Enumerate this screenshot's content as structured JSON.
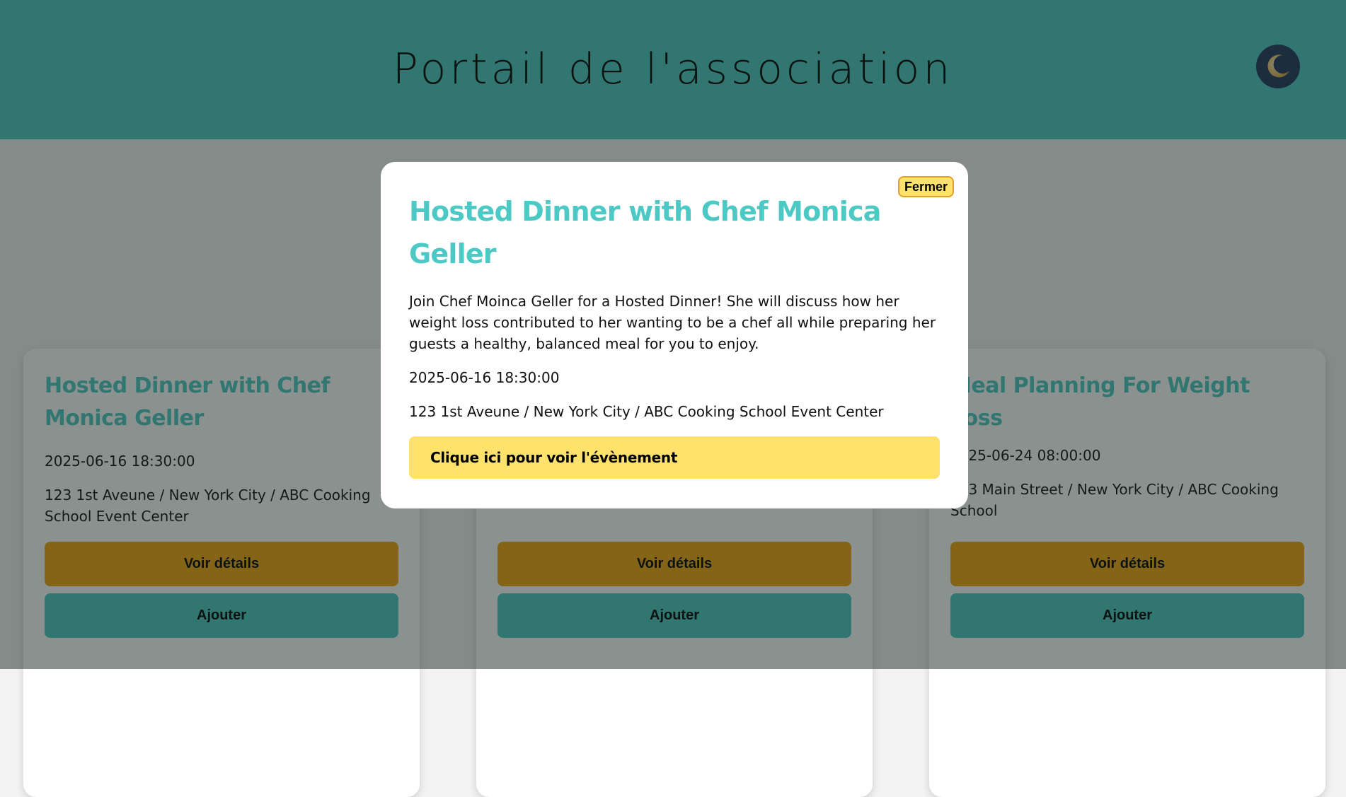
{
  "header": {
    "title": "Portail de l'association",
    "theme_icon": "crescent-moon-icon"
  },
  "events": [
    {
      "title": "Hosted Dinner with Chef Monica Geller",
      "date": "2025-06-16 18:30:00",
      "location": "123 1st Aveune / New York City / ABC Cooking School Event Center",
      "details_label": "Voir détails",
      "add_label": "Ajouter"
    },
    {
      "title": "",
      "date": "",
      "location": "",
      "details_label": "Voir détails",
      "add_label": "Ajouter"
    },
    {
      "title": "Meal Planning For Weight Loss",
      "date": "2025-06-24 08:00:00",
      "location": "123 Main Street / New York City / ABC Cooking School",
      "details_label": "Voir détails",
      "add_label": "Ajouter"
    }
  ],
  "modal": {
    "close_label": "Fermer",
    "title": "Hosted Dinner with Chef Monica Geller",
    "description": "Join Chef Moinca Geller for a Hosted Dinner! She will discuss how her weight loss contributed to her wanting to be a chef all while preparing her guests a healthy, balanced meal for you to enjoy.",
    "date": "2025-06-16 18:30:00",
    "location": "123 1st Aveune / New York City / ABC Cooking School Event Center",
    "link_label": "Clique ici pour voir l'évènement"
  },
  "colors": {
    "header_bg": "#4cc9c5",
    "title_accent": "#4cc9c5",
    "details_button": "#f2a50e",
    "add_button": "#4cc9c5",
    "modal_link_bg": "#ffe26b",
    "close_button_bg": "#ffe26b",
    "theme_toggle_bg": "#22375d"
  }
}
